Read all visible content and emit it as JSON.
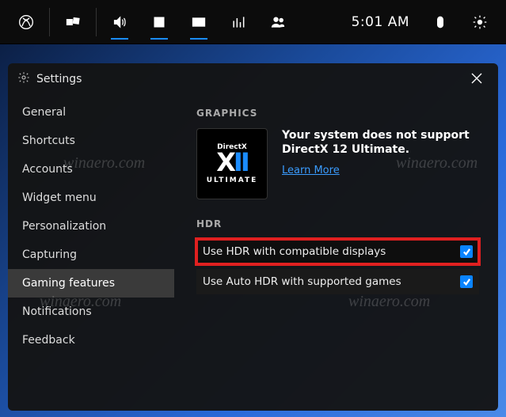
{
  "gamebar": {
    "time": "5:01 AM"
  },
  "panel": {
    "title": "Settings"
  },
  "sidebar": {
    "items": [
      {
        "label": "General"
      },
      {
        "label": "Shortcuts"
      },
      {
        "label": "Accounts"
      },
      {
        "label": "Widget menu"
      },
      {
        "label": "Personalization"
      },
      {
        "label": "Capturing"
      },
      {
        "label": "Gaming features"
      },
      {
        "label": "Notifications"
      },
      {
        "label": "Feedback"
      }
    ]
  },
  "graphics": {
    "header": "GRAPHICS",
    "tile_top": "DirectX",
    "tile_main_x": "X",
    "tile_main_ii": "II",
    "tile_bottom": "ULTIMATE",
    "message": "Your system does not support DirectX 12 Ultimate.",
    "link": "Learn More"
  },
  "hdr": {
    "header": "HDR",
    "opt1_label": "Use HDR with compatible displays",
    "opt1_checked": true,
    "opt2_label": "Use Auto HDR with supported games",
    "opt2_checked": true
  },
  "watermark": "winaero.com"
}
